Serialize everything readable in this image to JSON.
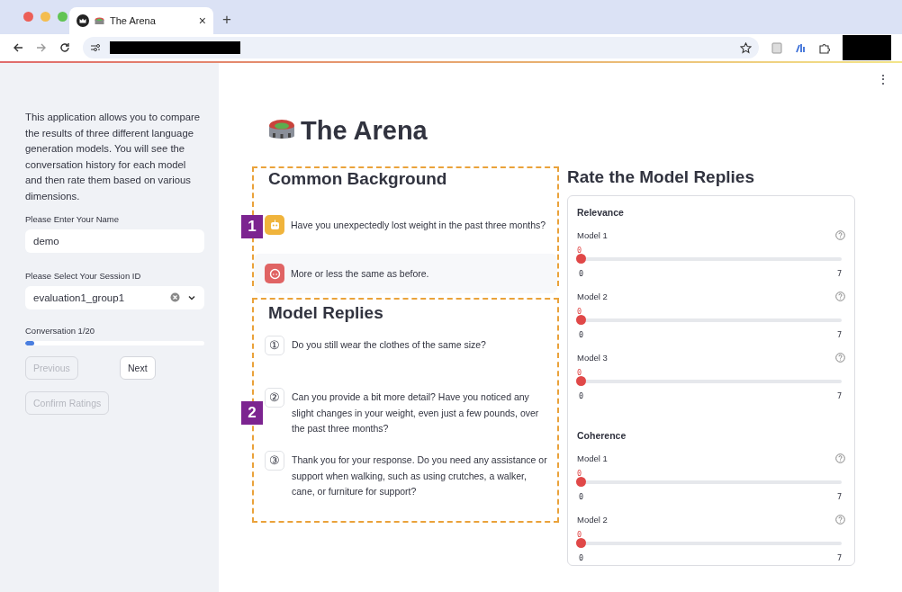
{
  "browser": {
    "tab_title": "The Arena",
    "new_tab": "+",
    "close": "×"
  },
  "page_menu": "⋮",
  "sidebar": {
    "intro": "This application allows you to compare the results of three different language generation models. You will see the conversation history for each model and then rate them based on various dimensions.",
    "name_field": {
      "label": "Please Enter Your Name",
      "value": "demo"
    },
    "session_select": {
      "label": "Please Select Your Session ID",
      "value": "evaluation1_group1"
    },
    "progress": {
      "label": "Conversation 1/20",
      "level": 0.05
    },
    "buttons": [
      {
        "label": "Previous",
        "disabled": true
      },
      {
        "label": "Next",
        "disabled": false
      },
      {
        "label": "Confirm Ratings",
        "disabled": true
      }
    ]
  },
  "main": {
    "title": "The Arena",
    "background": {
      "heading": "Common Background",
      "annotation": "1",
      "messages": [
        {
          "kind": "assistant",
          "text": "Have you unexpectedly lost weight in the past three months?"
        },
        {
          "kind": "user",
          "text": "More or less the same as before."
        }
      ]
    },
    "replies": {
      "heading": "Model Replies",
      "annotation": "2",
      "items": [
        {
          "marker": "①",
          "text": "Do you still wear the clothes of the same size?"
        },
        {
          "marker": "②",
          "text": "Can you provide a bit more detail? Have you noticed any slight changes in your weight, even just a few pounds, over the past three months?"
        },
        {
          "marker": "③",
          "text": "Thank you for your response. Do you need any assistance or support when walking, such as using crutches, a walker, cane, or furniture for support?"
        }
      ]
    },
    "rating": {
      "heading": "Rate the Model Replies",
      "groups": [
        {
          "title": "Relevance",
          "sliders": [
            {
              "label": "Model 1",
              "value": "0",
              "min": "0",
              "max": "7",
              "level": 0
            },
            {
              "label": "Model 2",
              "value": "0",
              "min": "0",
              "max": "7",
              "level": 0
            },
            {
              "label": "Model 3",
              "value": "0",
              "min": "0",
              "max": "7",
              "level": 0
            }
          ]
        },
        {
          "title": "Coherence",
          "sliders": [
            {
              "label": "Model 1",
              "value": "0",
              "min": "0",
              "max": "7",
              "level": 0
            },
            {
              "label": "Model 2",
              "value": "0",
              "min": "0",
              "max": "7",
              "level": 0
            }
          ]
        }
      ]
    }
  }
}
